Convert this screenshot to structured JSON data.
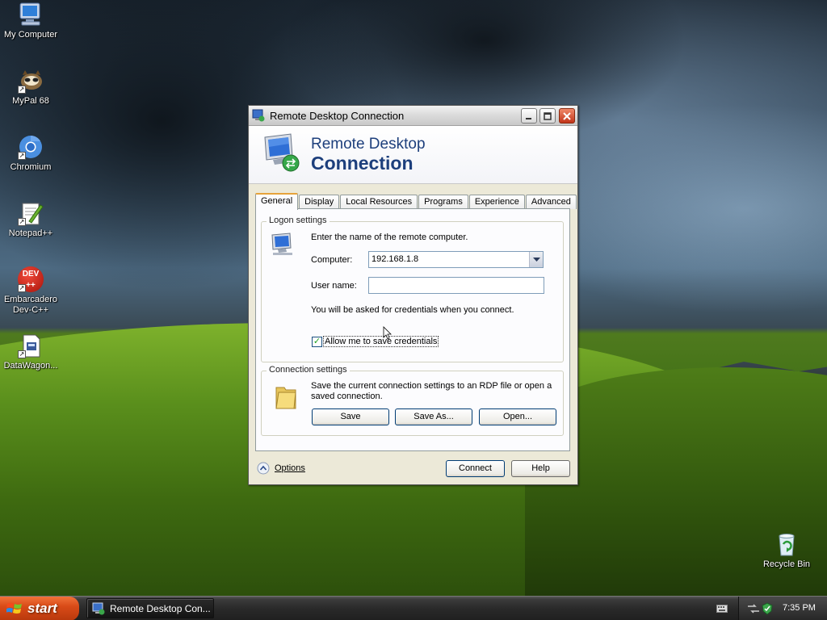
{
  "desktop": {
    "icons": [
      {
        "label": "My Computer"
      },
      {
        "label": "MyPal 68"
      },
      {
        "label": "Chromium"
      },
      {
        "label": "Notepad++"
      },
      {
        "label": "Embarcadero Dev-C++"
      },
      {
        "label": "DataWagon..."
      },
      {
        "label": "Recycle Bin"
      }
    ],
    "devcpp_badge": "DEV"
  },
  "window": {
    "title": "Remote Desktop Connection",
    "banner_line1": "Remote Desktop",
    "banner_line2": "Connection",
    "tabs": [
      {
        "label": "General",
        "active": true
      },
      {
        "label": "Display"
      },
      {
        "label": "Local Resources"
      },
      {
        "label": "Programs"
      },
      {
        "label": "Experience"
      },
      {
        "label": "Advanced"
      }
    ],
    "logon": {
      "group_label": "Logon settings",
      "instruction": "Enter the name of the remote computer.",
      "computer_label": "Computer:",
      "computer_value": "192.168.1.8",
      "username_label": "User name:",
      "username_value": "",
      "credentials_note": "You will be asked for credentials when you connect.",
      "allow_save_label": "Allow me to save credentials",
      "allow_save_checked": true
    },
    "connection": {
      "group_label": "Connection settings",
      "description": "Save the current connection settings to an RDP file or open a saved connection.",
      "save_label": "Save",
      "save_as_label": "Save As...",
      "open_label": "Open..."
    },
    "options_label": "Options",
    "connect_label": "Connect",
    "help_label": "Help"
  },
  "taskbar": {
    "start_label": "start",
    "task_label": "Remote Desktop Con...",
    "clock": "7:35 PM"
  }
}
